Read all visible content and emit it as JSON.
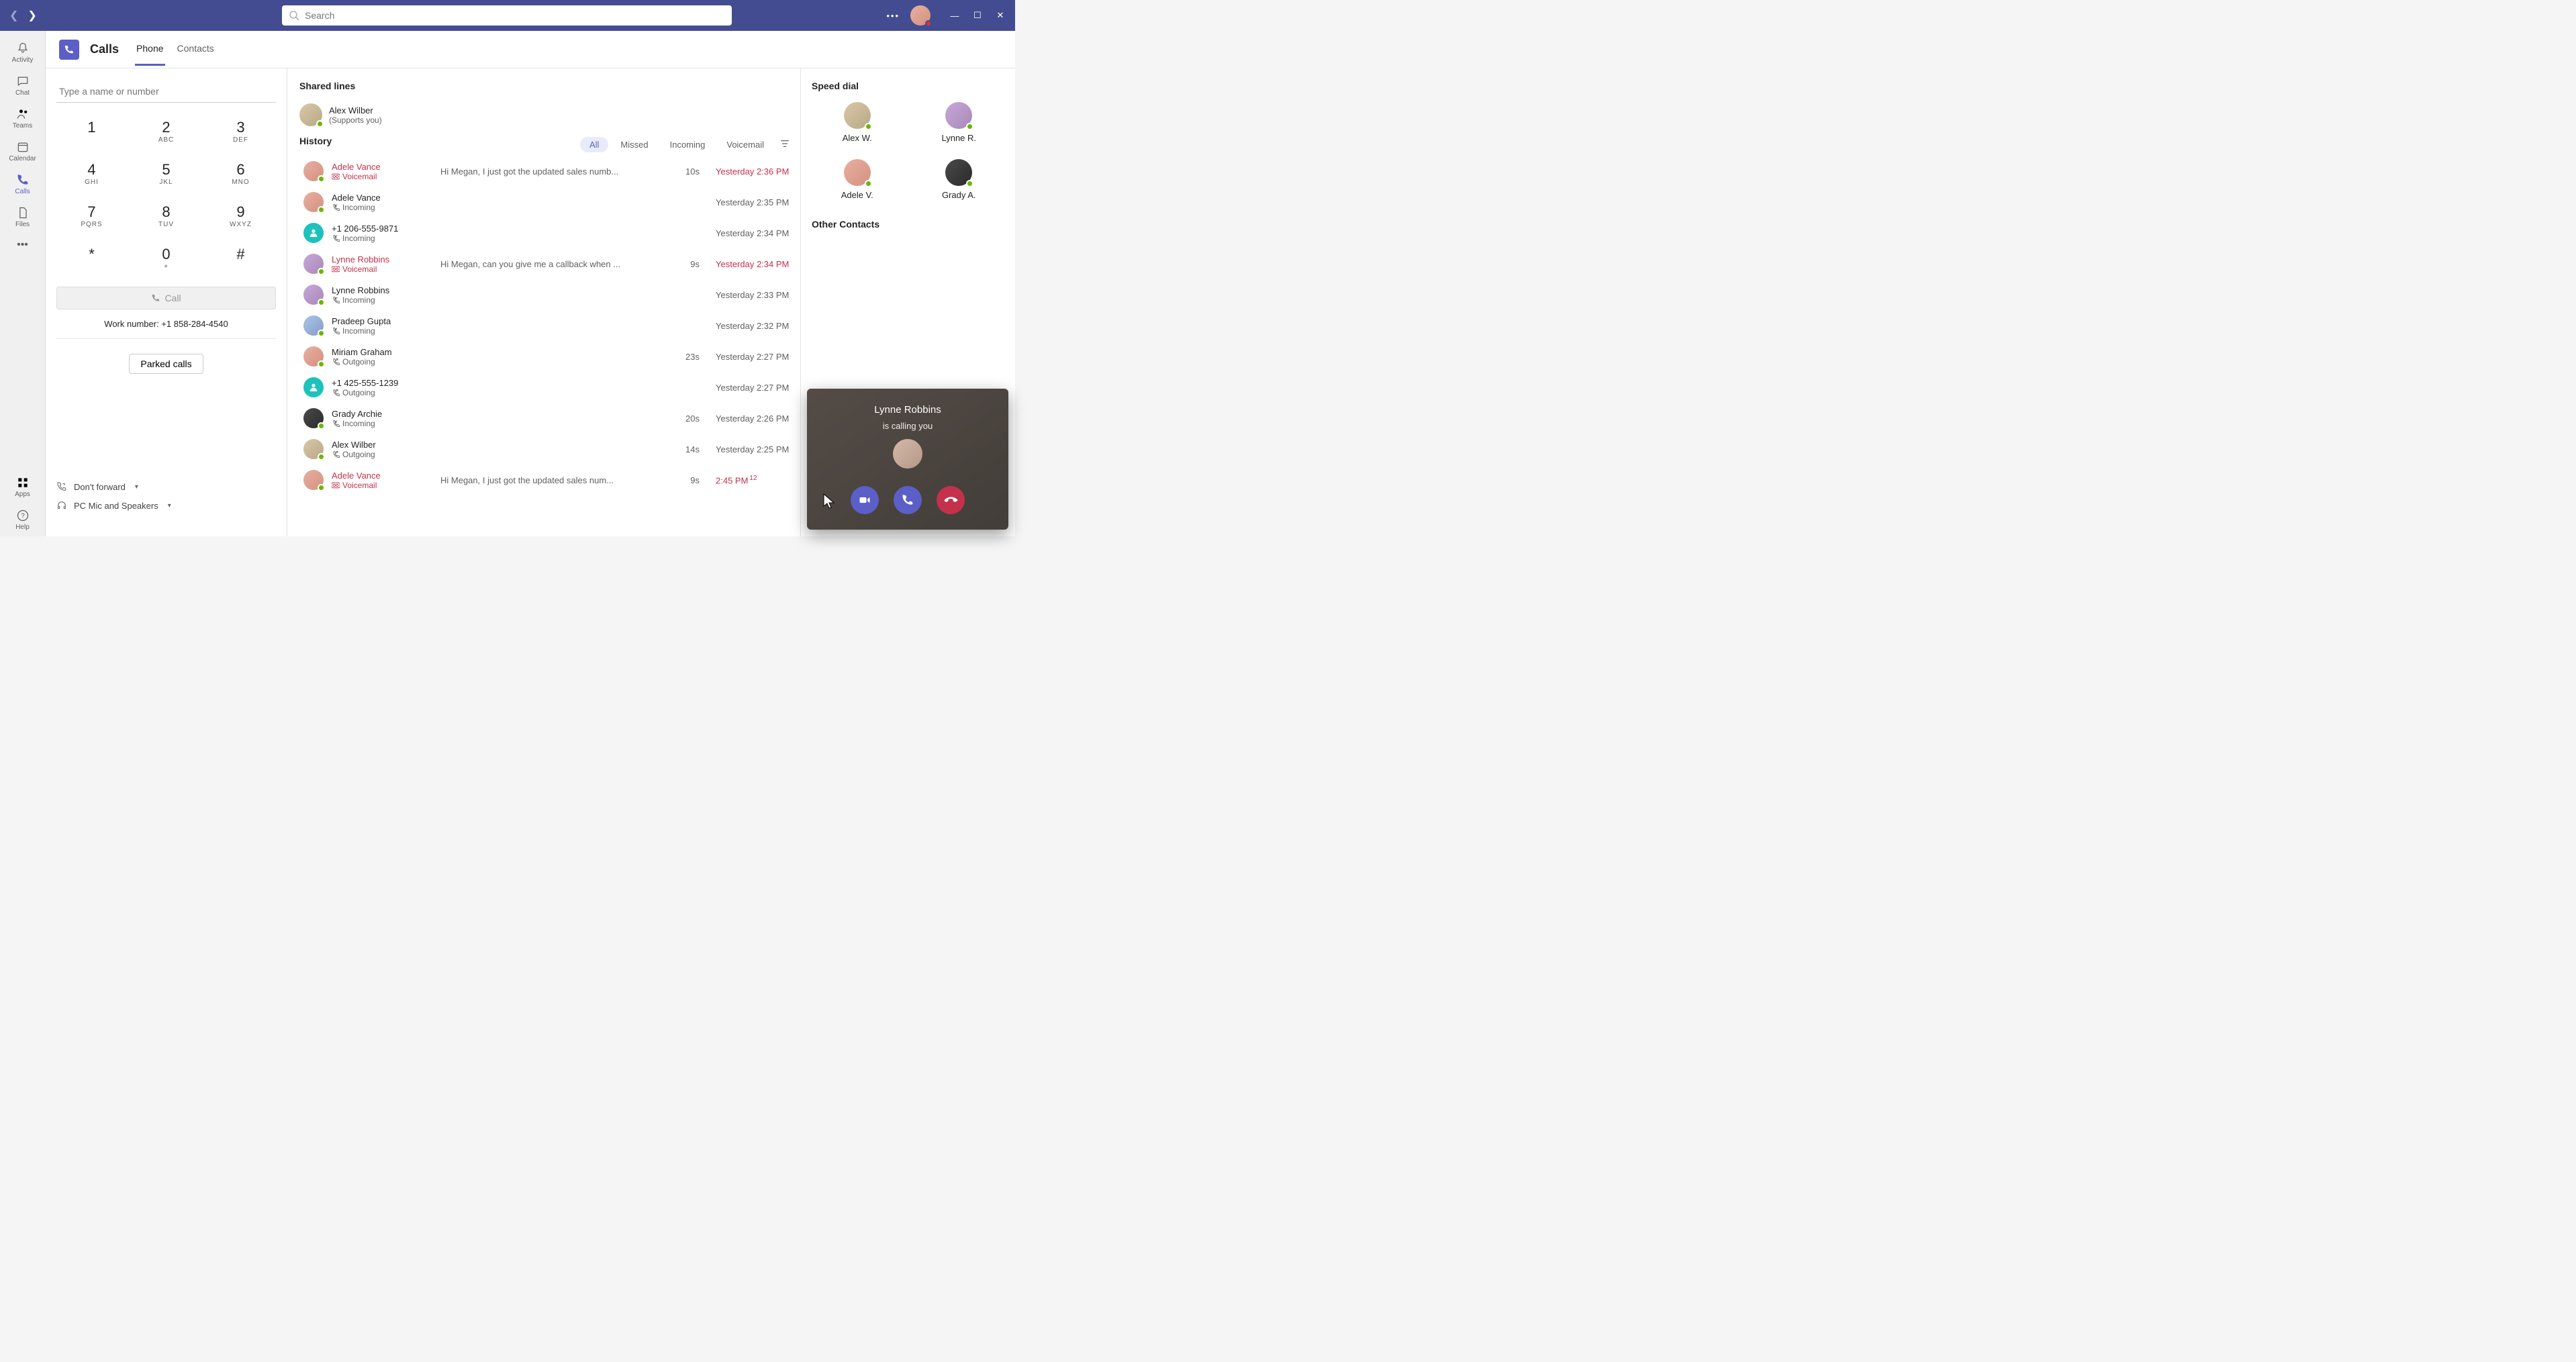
{
  "search": {
    "placeholder": "Search"
  },
  "left_rail": {
    "items": [
      {
        "label": "Activity"
      },
      {
        "label": "Chat"
      },
      {
        "label": "Teams"
      },
      {
        "label": "Calendar"
      },
      {
        "label": "Calls"
      },
      {
        "label": "Files"
      }
    ],
    "apps": "Apps",
    "help": "Help"
  },
  "header": {
    "title": "Calls",
    "tabs": [
      {
        "label": "Phone",
        "active": true
      },
      {
        "label": "Contacts",
        "active": false
      }
    ]
  },
  "dialer": {
    "placeholder": "Type a name or number",
    "keys": [
      {
        "num": "1",
        "sub": ""
      },
      {
        "num": "2",
        "sub": "ABC"
      },
      {
        "num": "3",
        "sub": "DEF"
      },
      {
        "num": "4",
        "sub": "GHI"
      },
      {
        "num": "5",
        "sub": "JKL"
      },
      {
        "num": "6",
        "sub": "MNO"
      },
      {
        "num": "7",
        "sub": "PQRS"
      },
      {
        "num": "8",
        "sub": "TUV"
      },
      {
        "num": "9",
        "sub": "WXYZ"
      },
      {
        "num": "*",
        "sub": ""
      },
      {
        "num": "0",
        "sub": "+"
      },
      {
        "num": "#",
        "sub": ""
      }
    ],
    "call_label": "Call",
    "work_number": "Work number: +1 858-284-4540",
    "parked_label": "Parked calls",
    "footer": {
      "forward": "Don't forward",
      "device": "PC Mic and Speakers"
    }
  },
  "shared": {
    "title": "Shared lines",
    "person_name": "Alex Wilber",
    "person_sub": "(Supports you)"
  },
  "history": {
    "title": "History",
    "filters": [
      {
        "label": "All",
        "active": true
      },
      {
        "label": "Missed",
        "active": false
      },
      {
        "label": "Incoming",
        "active": false
      },
      {
        "label": "Voicemail",
        "active": false
      }
    ],
    "rows": [
      {
        "name": "Adele Vance",
        "type": "Voicemail",
        "missed": true,
        "msg": "Hi Megan, I just got the updated sales numb...",
        "dur": "10s",
        "time": "Yesterday 2:36 PM",
        "avatar": "av-a"
      },
      {
        "name": "Adele Vance",
        "type": "Incoming",
        "missed": false,
        "msg": "",
        "dur": "",
        "time": "Yesterday 2:35 PM",
        "avatar": "av-a"
      },
      {
        "name": "+1 206-555-9871",
        "type": "Incoming",
        "missed": false,
        "msg": "",
        "dur": "",
        "time": "Yesterday 2:34 PM",
        "avatar": "av-c",
        "unknown": true
      },
      {
        "name": "Lynne Robbins",
        "type": "Voicemail",
        "missed": true,
        "msg": "Hi Megan, can you give me a callback when ...",
        "dur": "9s",
        "time": "Yesterday 2:34 PM",
        "avatar": "av-d"
      },
      {
        "name": "Lynne Robbins",
        "type": "Incoming",
        "missed": false,
        "msg": "",
        "dur": "",
        "time": "Yesterday 2:33 PM",
        "avatar": "av-d"
      },
      {
        "name": "Pradeep Gupta",
        "type": "Incoming",
        "missed": false,
        "msg": "",
        "dur": "",
        "time": "Yesterday 2:32 PM",
        "avatar": "av-b"
      },
      {
        "name": "Miriam Graham",
        "type": "Outgoing",
        "missed": false,
        "msg": "",
        "dur": "23s",
        "time": "Yesterday 2:27 PM",
        "avatar": "av-a"
      },
      {
        "name": "+1 425-555-1239",
        "type": "Outgoing",
        "missed": false,
        "msg": "",
        "dur": "",
        "time": "Yesterday 2:27 PM",
        "avatar": "av-c",
        "unknown": true
      },
      {
        "name": "Grady Archie",
        "type": "Incoming",
        "missed": false,
        "msg": "",
        "dur": "20s",
        "time": "Yesterday 2:26 PM",
        "avatar": "av-e"
      },
      {
        "name": "Alex Wilber",
        "type": "Outgoing",
        "missed": false,
        "msg": "",
        "dur": "14s",
        "time": "Yesterday 2:25 PM",
        "avatar": "av-f"
      },
      {
        "name": "Adele Vance",
        "type": "Voicemail",
        "missed": true,
        "msg": "Hi Megan, I just got the updated sales num...",
        "dur": "9s",
        "time": "2:45 PM",
        "badge": "12",
        "avatar": "av-a"
      }
    ]
  },
  "speed_dial": {
    "title": "Speed dial",
    "items": [
      {
        "label": "Alex W.",
        "avatar": "av-f"
      },
      {
        "label": "Lynne R.",
        "avatar": "av-d"
      },
      {
        "label": "Adele V.",
        "avatar": "av-a"
      },
      {
        "label": "Grady A.",
        "avatar": "av-e"
      }
    ],
    "other_title": "Other Contacts"
  },
  "toast": {
    "name": "Lynne Robbins",
    "sub": "is calling you"
  }
}
